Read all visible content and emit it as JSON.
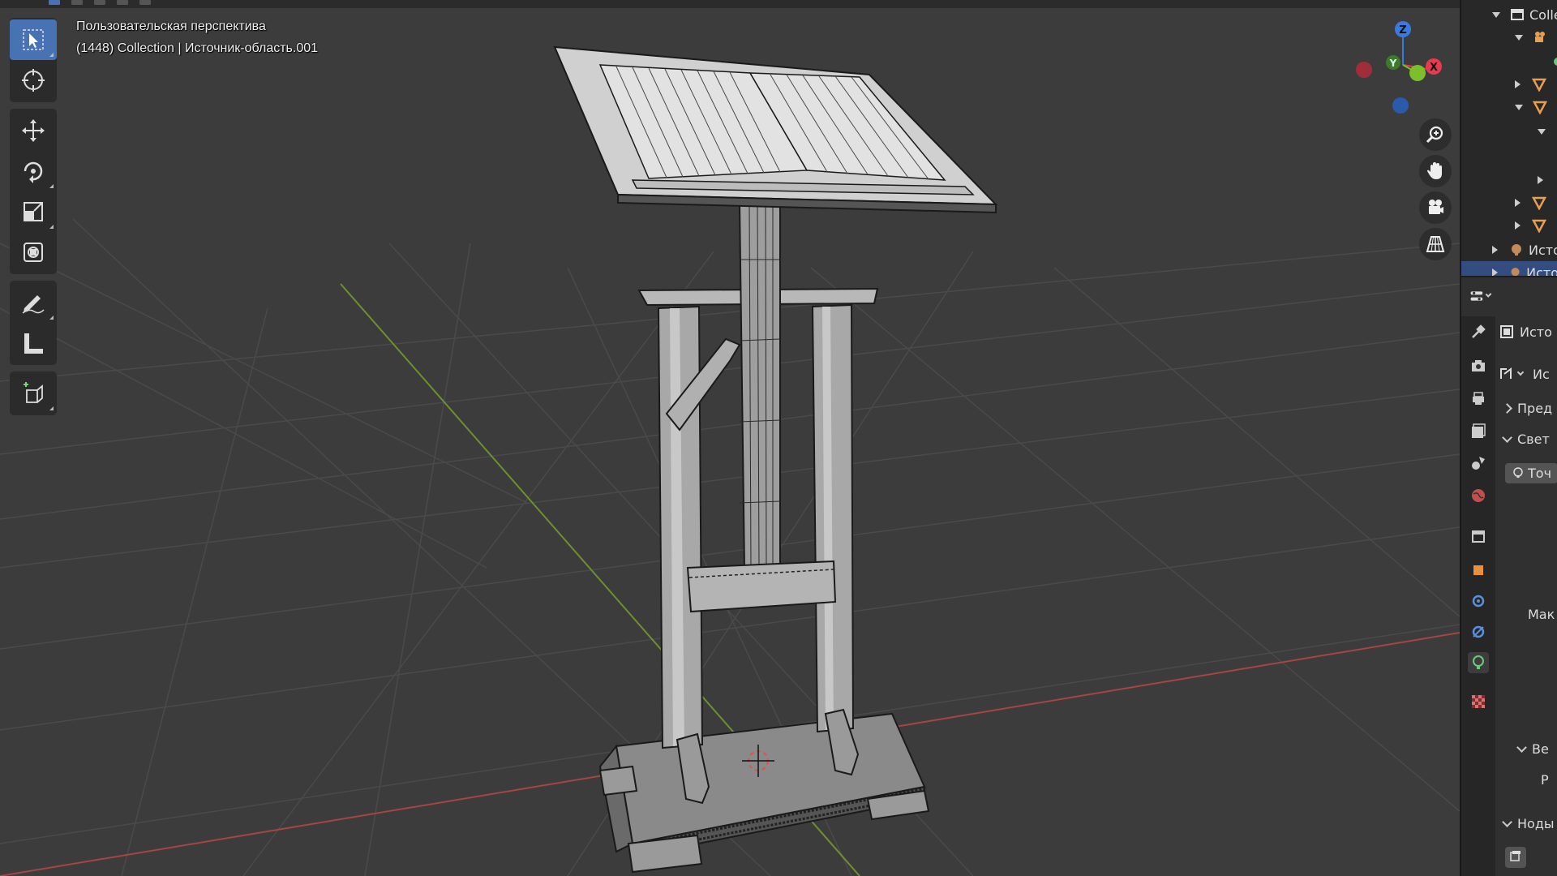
{
  "viewport": {
    "view_name": "Пользовательская перспектива",
    "object_info": "(1448) Collection | Источник-область.001"
  },
  "toolbar": {
    "tools": [
      {
        "name": "select-box-tool",
        "icon": "cursor-arrow-icon",
        "active": true
      },
      {
        "name": "cursor-tool",
        "icon": "crosshair-cursor-icon"
      },
      {
        "name": "move-tool",
        "icon": "move-arrows-icon"
      },
      {
        "name": "rotate-tool",
        "icon": "rotate-icon"
      },
      {
        "name": "scale-tool",
        "icon": "scale-icon"
      },
      {
        "name": "transform-tool",
        "icon": "transform-icon"
      },
      {
        "name": "annotate-tool",
        "icon": "pencil-icon"
      },
      {
        "name": "measure-tool",
        "icon": "ruler-icon"
      },
      {
        "name": "add-cube-tool",
        "icon": "add-cube-icon"
      }
    ]
  },
  "gizmo": {
    "z_label": "Z",
    "y_label": "Y",
    "x_label": "X",
    "colors": {
      "x": "#e83a4f",
      "y": "#7cbf2a",
      "z": "#3a7ae0"
    }
  },
  "nav_buttons": [
    "zoom-icon",
    "pan-hand-icon",
    "camera-icon",
    "grid-perspective-icon"
  ],
  "outliner": {
    "rows": [
      {
        "label": "Colle",
        "icon": "collection-icon"
      },
      {
        "label": "",
        "icon": "camera-object-icon"
      },
      {
        "label": "",
        "icon": "mesh-icon"
      },
      {
        "label": "",
        "icon": "mesh-icon"
      },
      {
        "label": "",
        "icon": "expand-icon"
      },
      {
        "label": "",
        "icon": "mesh-icon"
      },
      {
        "label": "",
        "icon": "mesh-icon"
      },
      {
        "label": "Исто",
        "icon": "light-icon"
      },
      {
        "label": "Исто",
        "icon": "light-icon",
        "selected": true
      }
    ]
  },
  "properties": {
    "header_label": "Исто",
    "data_label": "Ис",
    "sections": {
      "preview": "Пред",
      "light": "Свет",
      "point": "Точ",
      "max": "Мак",
      "ve": "Ве",
      "r": "Р",
      "nodes": "Ноды"
    },
    "accent_color": "#4772b3"
  }
}
